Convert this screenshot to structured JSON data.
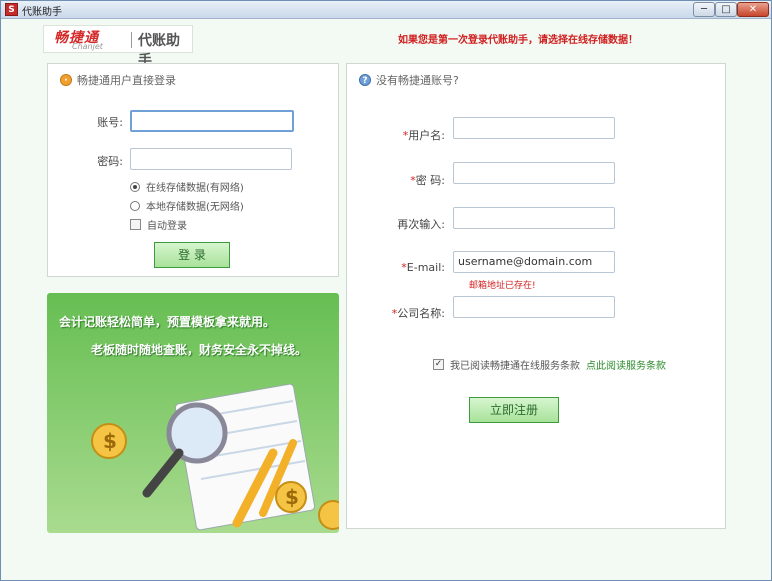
{
  "window": {
    "title": "代账助手",
    "buttons": [
      "─",
      "□",
      "✕"
    ]
  },
  "brand": {
    "name": "畅捷通",
    "sub": "Chanjet",
    "product": "代账助手"
  },
  "top_hint": "如果您是第一次登录代账助手，请选择在线存储数据！",
  "login": {
    "heading": "畅捷通用户直接登录",
    "account_label": "账号:",
    "password_label": "密码:",
    "account_value": "",
    "password_value": "",
    "options": {
      "online": "在线存储数据(有网络)",
      "local": "本地存储数据(无网络)",
      "auto": "自动登录"
    },
    "login_button": "登 录"
  },
  "banner": {
    "line1": "会计记账轻松简单，预置模板拿来就用。",
    "line2": "老板随时随地查账，财务安全永不掉线。"
  },
  "register": {
    "heading": "没有畅捷通账号?",
    "fields": {
      "username_label": "用户名:",
      "password_label": "密  码:",
      "confirm_label": "再次输入:",
      "email_label": "E-mail:",
      "company_label": "公司名称:",
      "email_value": "username@domain.com",
      "email_error": "邮箱地址已存在!"
    },
    "agree_text": "我已阅读畅捷通在线服务条款",
    "terms_link": "点此阅读服务条款",
    "register_button": "立即注册"
  },
  "colors": {
    "accent_green": "#a8e29a",
    "error_red": "#d01f1f",
    "focus_blue": "#6fa0d8"
  }
}
